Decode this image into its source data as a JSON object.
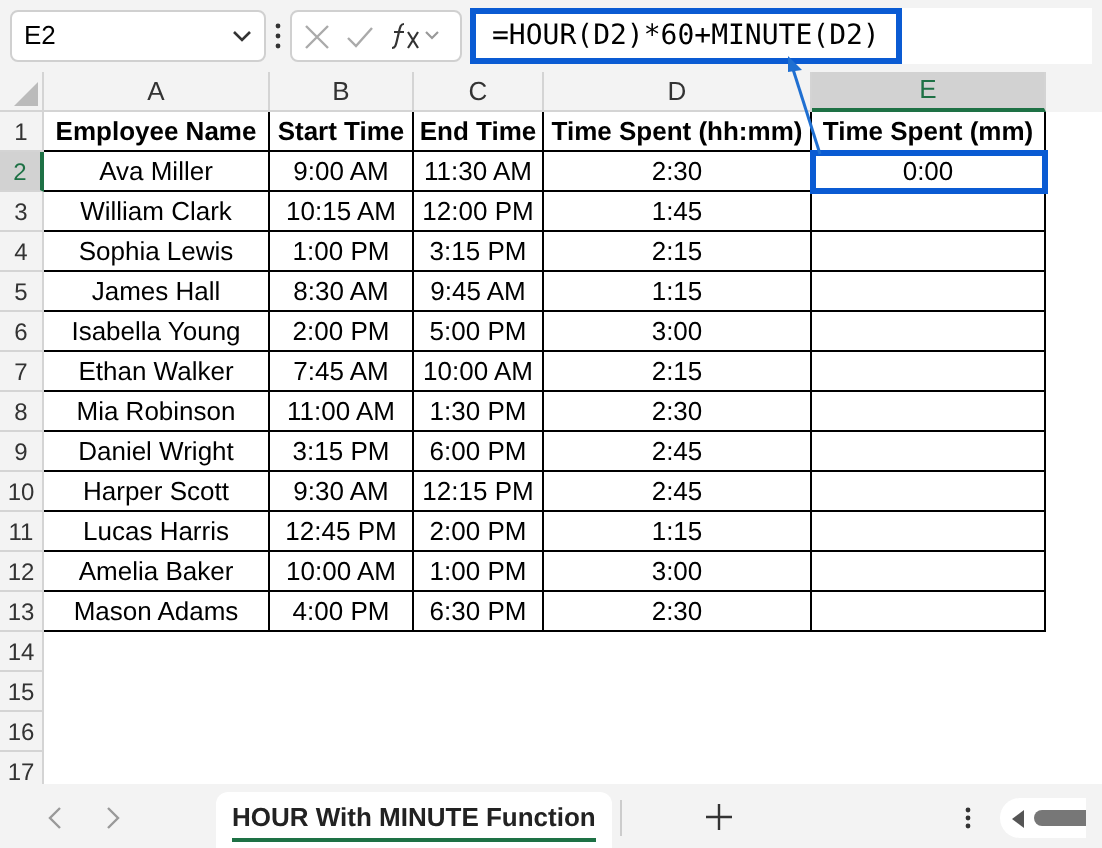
{
  "name_box": "E2",
  "formula": "=HOUR(D2)*60+MINUTE(D2)",
  "columns": [
    {
      "label": "A",
      "selected": false
    },
    {
      "label": "B",
      "selected": false
    },
    {
      "label": "C",
      "selected": false
    },
    {
      "label": "D",
      "selected": false
    },
    {
      "label": "E",
      "selected": true
    }
  ],
  "header_row": {
    "number": "1",
    "selected": false,
    "cells": [
      "Employee Name",
      "Start Time",
      "End Time",
      "Time Spent (hh:mm)",
      "Time Spent (mm)"
    ]
  },
  "rows": [
    {
      "number": "2",
      "selected": true,
      "cells": [
        "Ava Miller",
        "9:00 AM",
        "11:30 AM",
        "2:30",
        "0:00"
      ]
    },
    {
      "number": "3",
      "selected": false,
      "cells": [
        "William Clark",
        "10:15 AM",
        "12:00 PM",
        "1:45",
        ""
      ]
    },
    {
      "number": "4",
      "selected": false,
      "cells": [
        "Sophia Lewis",
        "1:00 PM",
        "3:15 PM",
        "2:15",
        ""
      ]
    },
    {
      "number": "5",
      "selected": false,
      "cells": [
        "James Hall",
        "8:30 AM",
        "9:45 AM",
        "1:15",
        ""
      ]
    },
    {
      "number": "6",
      "selected": false,
      "cells": [
        "Isabella Young",
        "2:00 PM",
        "5:00 PM",
        "3:00",
        ""
      ]
    },
    {
      "number": "7",
      "selected": false,
      "cells": [
        "Ethan Walker",
        "7:45 AM",
        "10:00 AM",
        "2:15",
        ""
      ]
    },
    {
      "number": "8",
      "selected": false,
      "cells": [
        "Mia Robinson",
        "11:00 AM",
        "1:30 PM",
        "2:30",
        ""
      ]
    },
    {
      "number": "9",
      "selected": false,
      "cells": [
        "Daniel Wright",
        "3:15 PM",
        "6:00 PM",
        "2:45",
        ""
      ]
    },
    {
      "number": "10",
      "selected": false,
      "cells": [
        "Harper Scott",
        "9:30 AM",
        "12:15 PM",
        "2:45",
        ""
      ]
    },
    {
      "number": "11",
      "selected": false,
      "cells": [
        "Lucas Harris",
        "12:45 PM",
        "2:00 PM",
        "1:15",
        ""
      ]
    },
    {
      "number": "12",
      "selected": false,
      "cells": [
        "Amelia Baker",
        "10:00 AM",
        "1:00 PM",
        "3:00",
        ""
      ]
    },
    {
      "number": "13",
      "selected": false,
      "cells": [
        "Mason Adams",
        "4:00 PM",
        "6:30 PM",
        "2:30",
        ""
      ]
    }
  ],
  "empty_rows": [
    "14",
    "15",
    "16",
    "17"
  ],
  "sheet_tabs": [
    {
      "label": "HOUR With MINUTE Function",
      "selected": true
    }
  ]
}
